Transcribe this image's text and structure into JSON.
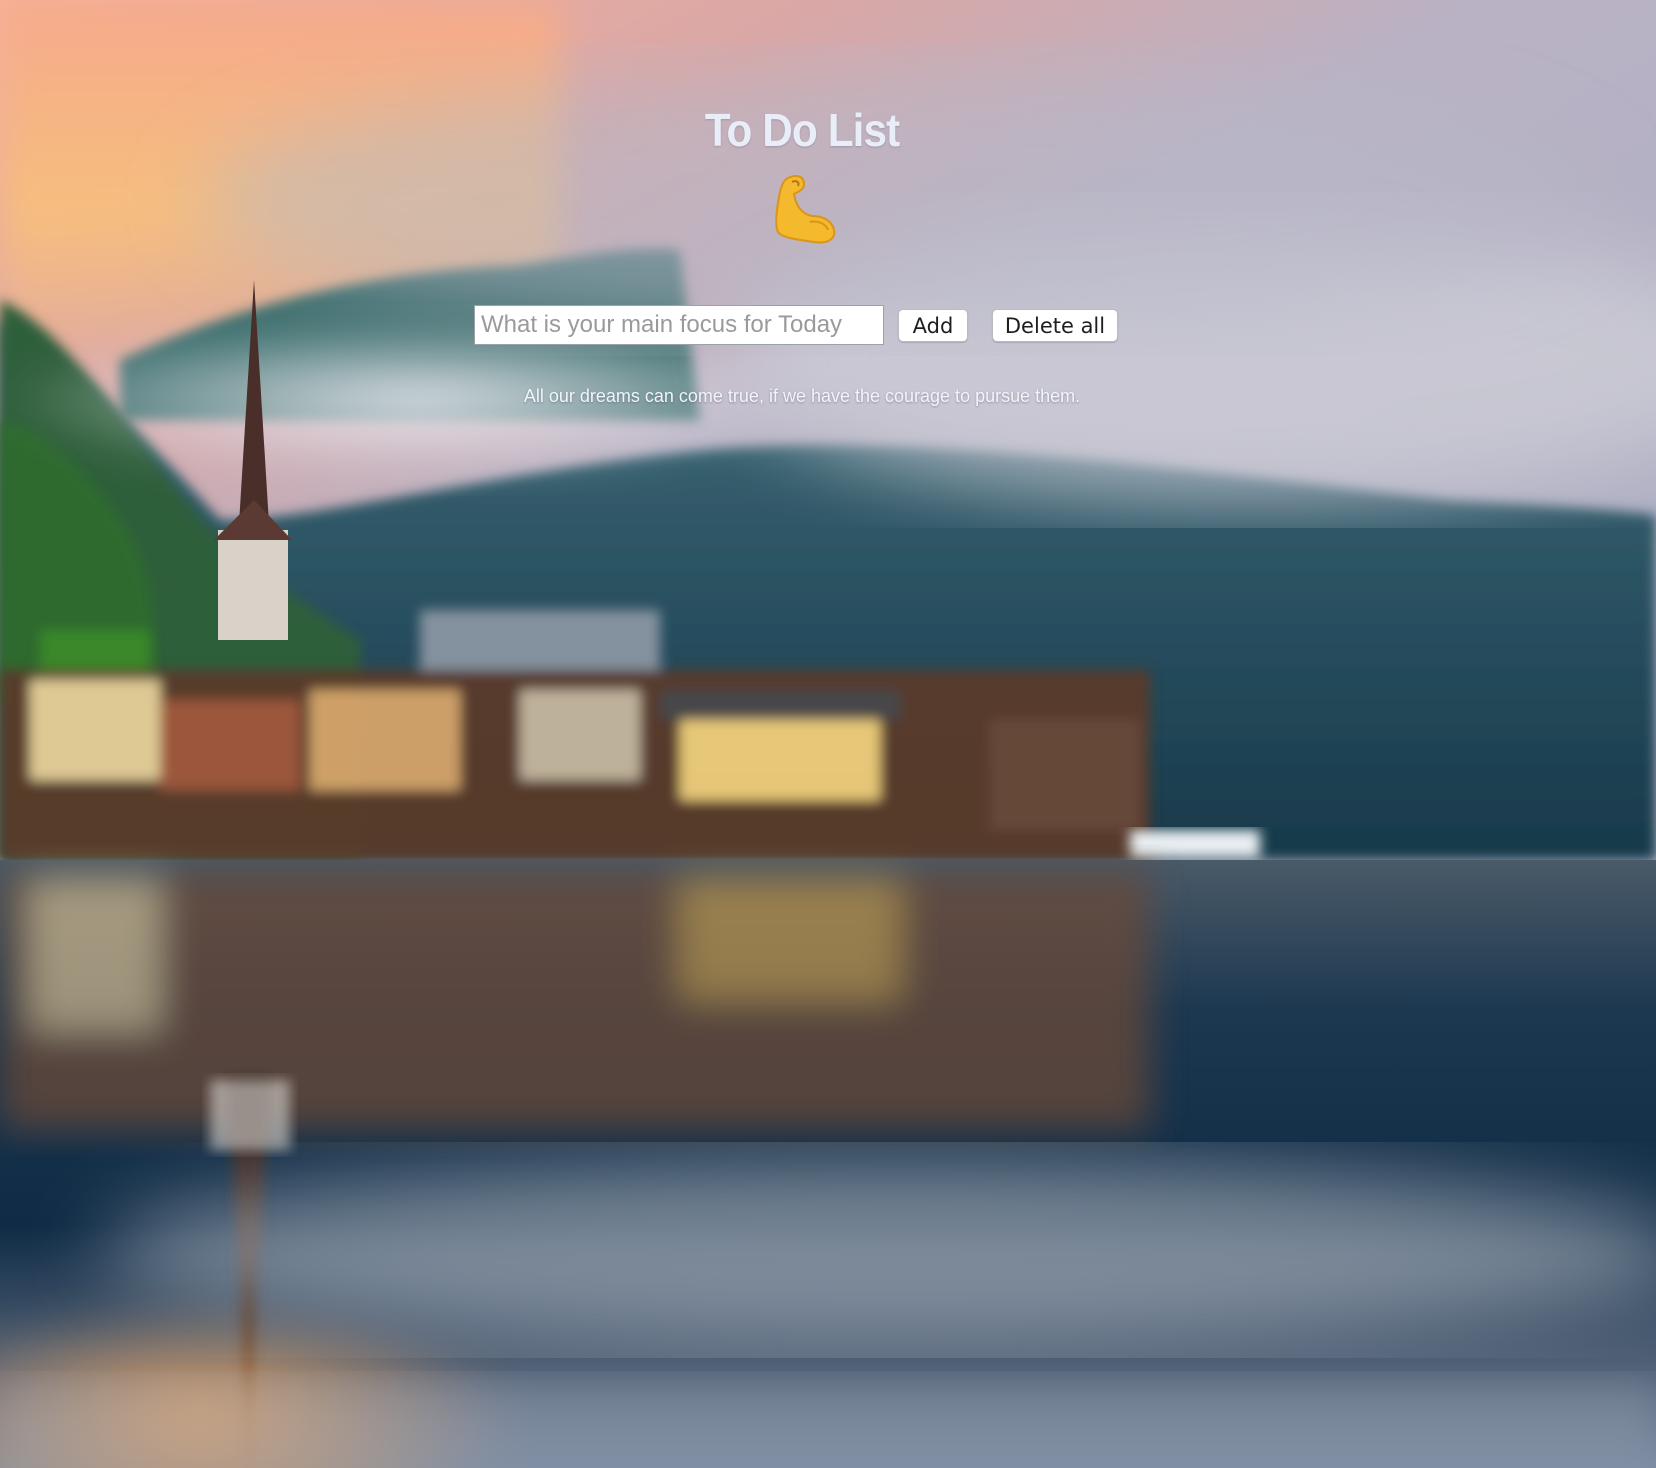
{
  "page": {
    "title": "To Do List",
    "emoji": "💪",
    "input": {
      "placeholder": "What is your main focus for Today",
      "value": ""
    },
    "buttons": {
      "add_label": "Add",
      "delete_all_label": "Delete all"
    },
    "quote": "All our dreams can come true, if we have the courage to pursue them."
  },
  "icons": {
    "emoji": "flexed-biceps-icon"
  },
  "colors": {
    "title_text": "#e8edf7",
    "quote_text": "#f2f4f8",
    "sky_warm": "#f6a98b",
    "lake_dark": "#0f2b45"
  }
}
